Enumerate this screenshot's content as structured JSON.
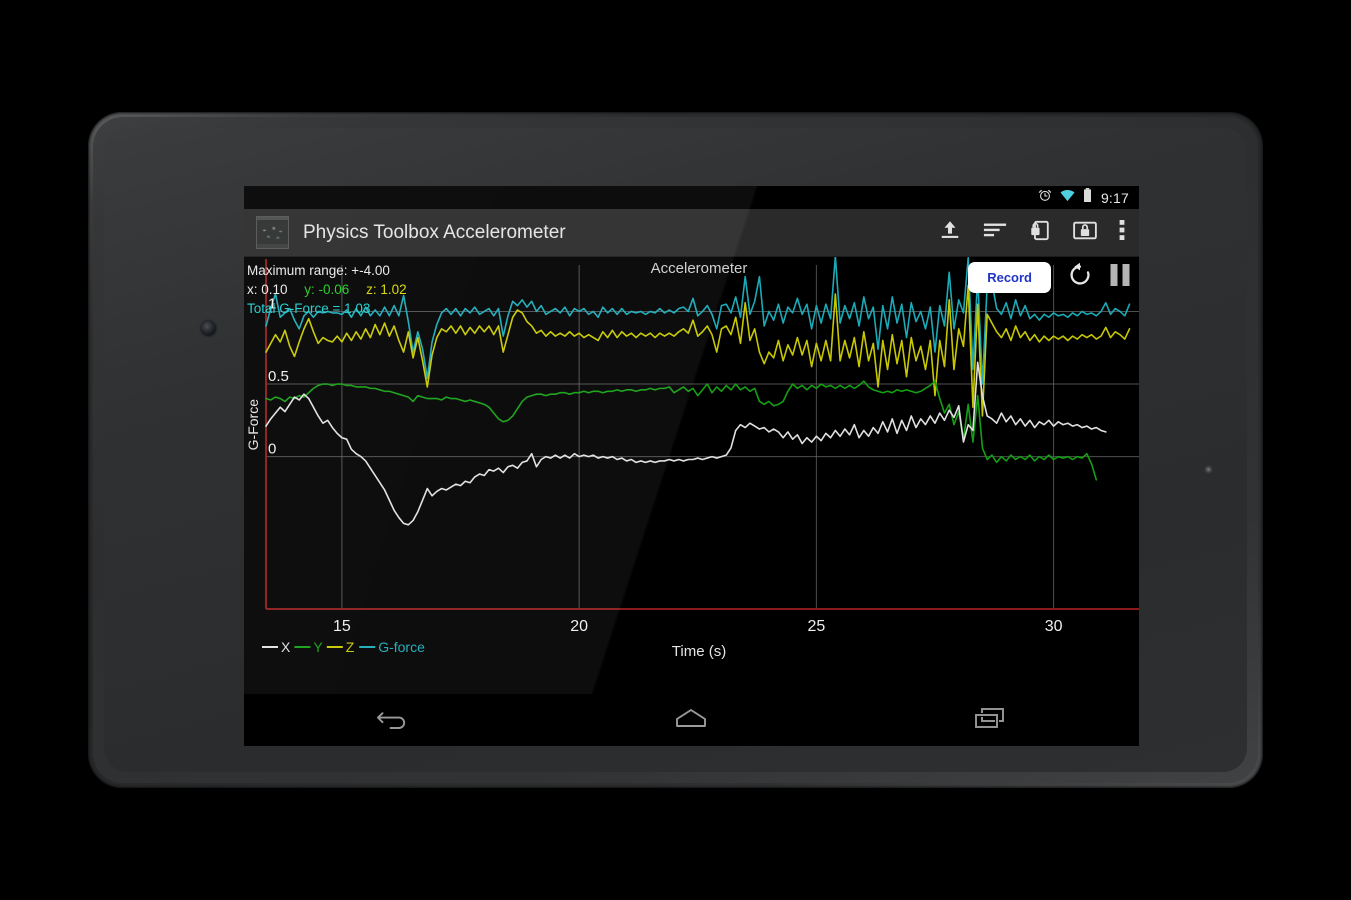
{
  "device": {
    "type": "android-tablet",
    "bezel_color": "#2d2f31"
  },
  "status_bar": {
    "icons": [
      "alarm-clock-icon",
      "wifi-icon",
      "battery-icon"
    ],
    "time": "9:17"
  },
  "action_bar": {
    "app_icon": "app-thumbnail-icon",
    "title": "Physics Toolbox Accelerometer",
    "icons": [
      {
        "name": "upload-export-icon",
        "label": "Export"
      },
      {
        "name": "data-lines-icon",
        "label": "Data display"
      },
      {
        "name": "lock-orientation-icon",
        "label": "Lock orientation"
      },
      {
        "name": "lock-screen-icon",
        "label": "Lock screen"
      },
      {
        "name": "overflow-menu-icon",
        "label": "More options"
      }
    ]
  },
  "readout": {
    "max_range_label": "Maximum range: +-4.00",
    "x_label": "x: 0.10",
    "y_label": "y: -0.06",
    "z_label": "z: 1.02",
    "total_label": "Total G-Force = 1.03",
    "colors": {
      "x": "#e9e9e9",
      "y": "#22cc22",
      "z": "#d8d800",
      "gforce": "#1ecece"
    }
  },
  "controls": {
    "record_label": "Record",
    "record_text_color": "#2034c8",
    "reset_icon": "reset-rotate-icon",
    "pause_icon": "pause-icon"
  },
  "nav_bar": {
    "back_icon": "back-arrow-icon",
    "home_icon": "home-icon",
    "recents_icon": "recent-apps-icon"
  },
  "chart_data": {
    "type": "line",
    "title": "Accelerometer",
    "xlabel": "Time (s)",
    "ylabel": "G-Force",
    "xlim": [
      13.4,
      31.8
    ],
    "ylim": [
      -1.05,
      1.32
    ],
    "xticks": [
      15,
      20,
      25,
      30
    ],
    "yticks": [
      0,
      0.5,
      1
    ],
    "grid": true,
    "axis_color": "#8b1a1a",
    "gridline_color": "#6a6a6a",
    "legend_position": "bottom-left",
    "legend": [
      {
        "name": "X",
        "color": "#e0e0e0"
      },
      {
        "name": "Y",
        "color": "#14a014"
      },
      {
        "name": "Z",
        "color": "#c8c800"
      },
      {
        "name": "G-force",
        "color": "#1aabb8"
      }
    ],
    "x": [
      13.4,
      13.5,
      13.6,
      13.7,
      13.8,
      13.9,
      14.0,
      14.1,
      14.2,
      14.3,
      14.4,
      14.5,
      14.6,
      14.7,
      14.8,
      14.9,
      15.0,
      15.1,
      15.2,
      15.3,
      15.4,
      15.5,
      15.6,
      15.7,
      15.8,
      15.9,
      16.0,
      16.1,
      16.2,
      16.3,
      16.4,
      16.5,
      16.6,
      16.7,
      16.8,
      16.9,
      17.0,
      17.1,
      17.2,
      17.3,
      17.4,
      17.5,
      17.6,
      17.7,
      17.8,
      17.9,
      18.0,
      18.1,
      18.2,
      18.3,
      18.4,
      18.5,
      18.6,
      18.7,
      18.8,
      18.9,
      19.0,
      19.1,
      19.2,
      19.3,
      19.4,
      19.5,
      19.6,
      19.7,
      19.8,
      19.9,
      20.0,
      20.1,
      20.2,
      20.3,
      20.4,
      20.5,
      20.6,
      20.7,
      20.8,
      20.9,
      21.0,
      21.1,
      21.2,
      21.3,
      21.4,
      21.5,
      21.6,
      21.7,
      21.8,
      21.9,
      22.0,
      22.1,
      22.2,
      22.3,
      22.4,
      22.5,
      22.6,
      22.7,
      22.8,
      22.9,
      23.0,
      23.1,
      23.2,
      23.3,
      23.4,
      23.5,
      23.6,
      23.7,
      23.8,
      23.9,
      24.0,
      24.1,
      24.2,
      24.3,
      24.4,
      24.5,
      24.6,
      24.7,
      24.8,
      24.9,
      25.0,
      25.1,
      25.2,
      25.3,
      25.4,
      25.5,
      25.6,
      25.7,
      25.8,
      25.9,
      26.0,
      26.1,
      26.2,
      26.3,
      26.4,
      26.5,
      26.6,
      26.7,
      26.8,
      26.9,
      27.0,
      27.1,
      27.2,
      27.3,
      27.4,
      27.5,
      27.6,
      27.7,
      27.8,
      27.9,
      28.0,
      28.1,
      28.2,
      28.3,
      28.4,
      28.5,
      28.6,
      28.7,
      28.8,
      28.9,
      29.0,
      29.1,
      29.2,
      29.3,
      29.4,
      29.5,
      29.6,
      29.7,
      29.8,
      29.9,
      30.0,
      30.1,
      30.2,
      30.3,
      30.4,
      30.5,
      30.6,
      30.7,
      30.8,
      30.9,
      31.0,
      31.1,
      31.2,
      31.3,
      31.4,
      31.5,
      31.6,
      31.7
    ],
    "series": [
      {
        "name": "G-force",
        "color": "#1aabb8",
        "values": [
          0.9,
          1.02,
          1.12,
          0.96,
          0.99,
          1.02,
          0.94,
          0.88,
          0.97,
          1.0,
          0.96,
          1.0,
          0.99,
          1.0,
          0.99,
          0.99,
          0.98,
          1.01,
          0.96,
          1.02,
          0.97,
          1.03,
          0.97,
          1.01,
          0.97,
          1.03,
          0.97,
          1.04,
          0.97,
          1.11,
          0.93,
          0.72,
          0.86,
          0.74,
          0.54,
          0.79,
          0.91,
          0.99,
          1.02,
          0.98,
          1.02,
          0.97,
          1.02,
          0.99,
          1.03,
          0.98,
          1.0,
          1.02,
          0.97,
          1.02,
          0.83,
          0.97,
          1.07,
          1.04,
          1.08,
          1.03,
          1.07,
          1.0,
          1.04,
          0.98,
          1.0,
          1.02,
          0.99,
          1.03,
          0.97,
          1.02,
          1.0,
          1.02,
          0.98,
          1.0,
          0.96,
          1.03,
          0.99,
          1.02,
          0.98,
          1.02,
          0.98,
          1.0,
          0.99,
          1.0,
          0.98,
          1.0,
          0.99,
          1.02,
          0.99,
          1.01,
          0.99,
          1.02,
          1.03,
          1.0,
          1.09,
          0.97,
          1.0,
          1.04,
          0.98,
          0.88,
          1.04,
          1.05,
          0.99,
          1.1,
          0.96,
          1.24,
          0.98,
          1.07,
          1.24,
          0.9,
          1.0,
          0.94,
          1.05,
          0.92,
          1.03,
          0.99,
          1.09,
          0.98,
          1.05,
          0.88,
          1.04,
          0.92,
          1.05,
          0.95,
          1.38,
          0.92,
          1.04,
          0.95,
          1.06,
          0.9,
          1.1,
          0.95,
          1.03,
          0.74,
          1.04,
          0.88,
          1.1,
          0.92,
          1.05,
          0.82,
          1.06,
          0.93,
          1.0,
          0.88,
          1.03,
          0.72,
          1.04,
          0.9,
          1.27,
          0.88,
          1.08,
          0.99,
          1.37,
          0.6,
          1.24,
          0.5,
          1.18,
          1.2,
          1.02,
          0.98,
          1.06,
          0.95,
          1.08,
          0.97,
          1.04,
          0.95,
          0.98,
          0.94,
          0.98,
          0.96,
          0.99,
          0.97,
          0.98,
          0.96,
          0.99,
          0.97,
          1.0,
          0.98,
          0.99,
          0.97,
          1.0,
          1.06,
          0.98,
          1.02,
          1.0,
          0.97,
          1.05
        ]
      },
      {
        "name": "Z",
        "color": "#c8c800",
        "values": [
          0.72,
          0.78,
          0.84,
          0.79,
          0.87,
          0.76,
          0.69,
          0.79,
          0.88,
          0.95,
          0.86,
          0.78,
          0.82,
          0.8,
          0.79,
          0.83,
          0.79,
          0.85,
          0.8,
          0.86,
          0.81,
          0.88,
          0.82,
          0.91,
          0.84,
          0.92,
          0.83,
          0.9,
          0.8,
          0.72,
          0.86,
          0.68,
          0.82,
          0.66,
          0.48,
          0.7,
          0.82,
          0.88,
          0.86,
          0.9,
          0.85,
          0.9,
          0.84,
          0.89,
          0.85,
          0.9,
          0.86,
          0.9,
          0.84,
          0.9,
          0.72,
          0.84,
          0.96,
          1.01,
          0.99,
          0.93,
          0.9,
          0.85,
          0.87,
          0.83,
          0.86,
          0.83,
          0.85,
          0.83,
          0.86,
          0.83,
          0.85,
          0.82,
          0.84,
          0.82,
          0.8,
          0.86,
          0.82,
          0.87,
          0.82,
          0.86,
          0.83,
          0.85,
          0.82,
          0.85,
          0.83,
          0.85,
          0.82,
          0.85,
          0.83,
          0.85,
          0.83,
          0.86,
          0.88,
          0.85,
          0.94,
          0.83,
          0.86,
          0.9,
          0.84,
          0.72,
          0.88,
          0.9,
          0.84,
          0.96,
          0.78,
          1.06,
          0.8,
          0.88,
          0.72,
          0.64,
          0.72,
          0.68,
          0.8,
          0.66,
          0.77,
          0.7,
          0.82,
          0.7,
          0.8,
          0.62,
          0.78,
          0.66,
          0.8,
          0.66,
          1.12,
          0.66,
          0.8,
          0.68,
          0.82,
          0.62,
          0.86,
          0.66,
          0.78,
          0.48,
          0.8,
          0.6,
          0.84,
          0.64,
          0.8,
          0.55,
          0.82,
          0.66,
          0.76,
          0.6,
          0.8,
          0.42,
          0.8,
          0.62,
          1.08,
          0.6,
          0.88,
          0.76,
          1.18,
          0.34,
          1.05,
          0.28,
          0.98,
          0.92,
          0.86,
          0.82,
          0.88,
          0.8,
          0.9,
          0.82,
          0.86,
          0.8,
          0.84,
          0.79,
          0.83,
          0.8,
          0.83,
          0.81,
          0.83,
          0.8,
          0.83,
          0.81,
          0.84,
          0.82,
          0.84,
          0.81,
          0.83,
          0.89,
          0.82,
          0.86,
          0.84,
          0.81,
          0.88
        ]
      },
      {
        "name": "Y",
        "color": "#14a014",
        "values": [
          0.4,
          0.39,
          0.41,
          0.4,
          0.38,
          0.41,
          0.4,
          0.42,
          0.41,
          0.44,
          0.47,
          0.49,
          0.5,
          0.5,
          0.49,
          0.5,
          0.5,
          0.49,
          0.49,
          0.48,
          0.48,
          0.48,
          0.47,
          0.47,
          0.46,
          0.45,
          0.45,
          0.44,
          0.43,
          0.42,
          0.41,
          0.38,
          0.42,
          0.41,
          0.4,
          0.4,
          0.4,
          0.39,
          0.41,
          0.4,
          0.4,
          0.39,
          0.38,
          0.39,
          0.38,
          0.37,
          0.36,
          0.34,
          0.3,
          0.26,
          0.24,
          0.25,
          0.28,
          0.33,
          0.38,
          0.41,
          0.42,
          0.43,
          0.43,
          0.42,
          0.43,
          0.43,
          0.44,
          0.44,
          0.43,
          0.44,
          0.44,
          0.45,
          0.44,
          0.45,
          0.45,
          0.44,
          0.45,
          0.45,
          0.46,
          0.45,
          0.46,
          0.46,
          0.45,
          0.46,
          0.46,
          0.47,
          0.46,
          0.47,
          0.47,
          0.48,
          0.44,
          0.46,
          0.48,
          0.45,
          0.47,
          0.42,
          0.46,
          0.5,
          0.44,
          0.48,
          0.45,
          0.49,
          0.46,
          0.5,
          0.46,
          0.48,
          0.45,
          0.47,
          0.38,
          0.36,
          0.38,
          0.35,
          0.36,
          0.38,
          0.45,
          0.5,
          0.47,
          0.49,
          0.46,
          0.49,
          0.47,
          0.5,
          0.48,
          0.49,
          0.47,
          0.49,
          0.47,
          0.49,
          0.47,
          0.49,
          0.52,
          0.48,
          0.46,
          0.45,
          0.44,
          0.45,
          0.44,
          0.46,
          0.45,
          0.46,
          0.45,
          0.44,
          0.45,
          0.47,
          0.49,
          0.52,
          0.4,
          0.3,
          0.36,
          0.22,
          0.31,
          0.12,
          0.36,
          0.1,
          0.42,
          0.06,
          -0.02,
          0.01,
          -0.04,
          0.0,
          -0.03,
          0.01,
          -0.02,
          0.0,
          -0.02,
          0.01,
          -0.03,
          0.0,
          -0.02,
          0.01,
          -0.02,
          0.0,
          -0.01,
          0.0,
          -0.02,
          0.0,
          -0.01,
          0.02,
          -0.05,
          -0.16
        ]
      },
      {
        "name": "X",
        "color": "#e0e0e0",
        "values": [
          0.21,
          0.26,
          0.3,
          0.34,
          0.31,
          0.36,
          0.41,
          0.39,
          0.43,
          0.4,
          0.34,
          0.28,
          0.23,
          0.25,
          0.2,
          0.16,
          0.13,
          0.12,
          0.05,
          0.02,
          0.0,
          -0.03,
          -0.08,
          -0.13,
          -0.18,
          -0.23,
          -0.3,
          -0.37,
          -0.42,
          -0.46,
          -0.47,
          -0.44,
          -0.38,
          -0.3,
          -0.22,
          -0.27,
          -0.24,
          -0.22,
          -0.23,
          -0.21,
          -0.19,
          -0.2,
          -0.17,
          -0.18,
          -0.14,
          -0.12,
          -0.13,
          -0.09,
          -0.1,
          -0.08,
          -0.11,
          -0.07,
          -0.06,
          -0.08,
          -0.04,
          -0.03,
          0.02,
          -0.07,
          -0.02,
          0.0,
          -0.01,
          0.01,
          -0.01,
          0.01,
          -0.01,
          0.02,
          0.0,
          0.01,
          0.0,
          0.01,
          -0.01,
          0.0,
          -0.01,
          0.0,
          -0.02,
          -0.01,
          -0.03,
          -0.02,
          -0.04,
          -0.03,
          -0.04,
          -0.03,
          -0.04,
          -0.03,
          -0.03,
          -0.02,
          -0.03,
          -0.02,
          -0.03,
          -0.02,
          -0.02,
          -0.01,
          -0.02,
          -0.01,
          0.0,
          -0.01,
          0.0,
          0.01,
          0.06,
          0.18,
          0.22,
          0.2,
          0.23,
          0.21,
          0.19,
          0.2,
          0.17,
          0.19,
          0.17,
          0.13,
          0.17,
          0.12,
          0.15,
          0.09,
          0.13,
          0.1,
          0.14,
          0.11,
          0.16,
          0.13,
          0.18,
          0.14,
          0.19,
          0.15,
          0.22,
          0.13,
          0.18,
          0.14,
          0.2,
          0.16,
          0.24,
          0.17,
          0.26,
          0.16,
          0.25,
          0.18,
          0.28,
          0.2,
          0.26,
          0.22,
          0.28,
          0.23,
          0.3,
          0.25,
          0.32,
          0.27,
          0.35,
          0.1,
          0.22,
          0.18,
          0.65,
          0.42,
          0.28,
          0.26,
          0.23,
          0.3,
          0.24,
          0.28,
          0.22,
          0.26,
          0.21,
          0.25,
          0.2,
          0.24,
          0.22,
          0.25,
          0.21,
          0.24,
          0.22,
          0.23,
          0.21,
          0.22,
          0.2,
          0.21,
          0.19,
          0.2,
          0.18,
          0.17
        ]
      }
    ]
  }
}
